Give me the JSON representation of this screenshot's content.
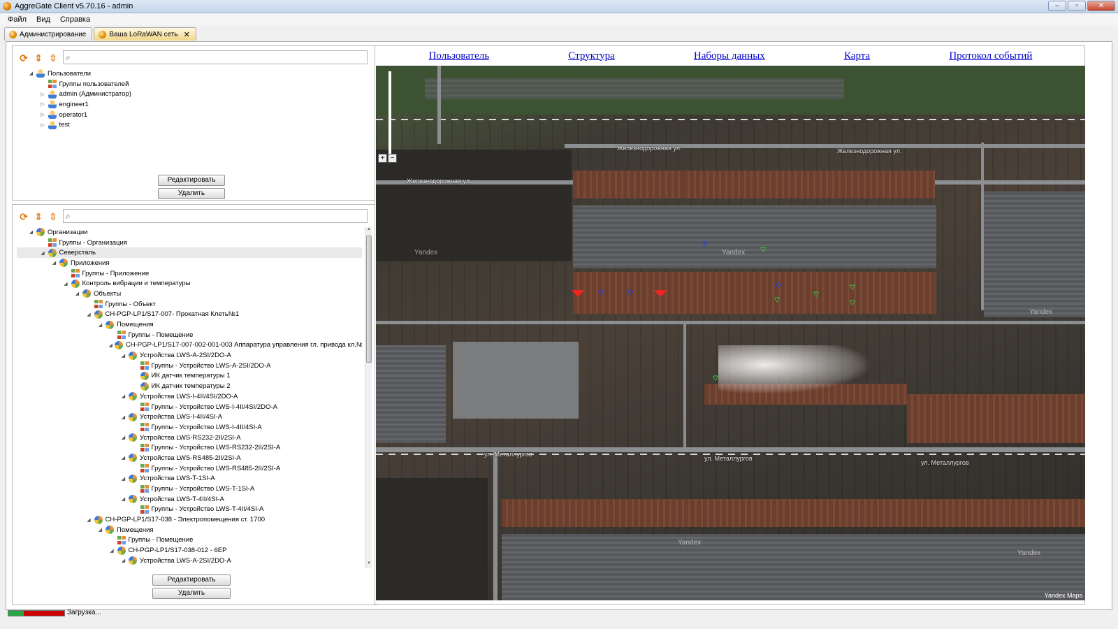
{
  "window": {
    "title": "AggreGate Client v5.70.16 - admin",
    "minimize": "–",
    "maximize": "▫",
    "close": "✕"
  },
  "menu": [
    "Файл",
    "Вид",
    "Справка"
  ],
  "tabs": [
    {
      "label": "Администрирование",
      "active": false
    },
    {
      "label": "Ваша LoRaWAN сеть",
      "active": true,
      "close": "✕"
    }
  ],
  "top_panel": {
    "search_placeholder": "",
    "tree": [
      {
        "label": "Пользователи",
        "level": 0,
        "twisty": "◢",
        "icon": "user"
      },
      {
        "label": "Группы пользователей",
        "level": 1,
        "twisty": "",
        "icon": "grid"
      },
      {
        "label": "admin (Администратор)",
        "level": 1,
        "twisty": "▷",
        "icon": "user"
      },
      {
        "label": "engineer1",
        "level": 1,
        "twisty": "▷",
        "icon": "user"
      },
      {
        "label": "operator1",
        "level": 1,
        "twisty": "▷",
        "icon": "user"
      },
      {
        "label": "test",
        "level": 1,
        "twisty": "▷",
        "icon": "user"
      }
    ],
    "edit_label": "Редактировать",
    "delete_label": "Удалить"
  },
  "bottom_panel": {
    "search_placeholder": "",
    "tree": [
      {
        "label": "Организации",
        "level": 0,
        "twisty": "◢",
        "icon": "globe"
      },
      {
        "label": "Группы - Организация",
        "level": 1,
        "twisty": "",
        "icon": "grid"
      },
      {
        "label": "Северсталь",
        "level": 1,
        "twisty": "◢",
        "icon": "globe",
        "selected": true
      },
      {
        "label": "Приложения",
        "level": 2,
        "twisty": "◢",
        "icon": "globe"
      },
      {
        "label": "Группы - Приложение",
        "level": 3,
        "twisty": "",
        "icon": "grid"
      },
      {
        "label": "Контроль вибрации и температуры",
        "level": 3,
        "twisty": "◢",
        "icon": "globe"
      },
      {
        "label": "Объекты",
        "level": 4,
        "twisty": "◢",
        "icon": "globe"
      },
      {
        "label": "Группы - Объект",
        "level": 5,
        "twisty": "",
        "icon": "grid"
      },
      {
        "label": "CH-PGP-LP1/S17-007- Прокатная Клеть№1",
        "level": 5,
        "twisty": "◢",
        "icon": "globe"
      },
      {
        "label": "Помещения",
        "level": 6,
        "twisty": "◢",
        "icon": "globe"
      },
      {
        "label": "Группы - Помещение",
        "level": 7,
        "twisty": "",
        "icon": "grid"
      },
      {
        "label": "CH-PGP-LP1/S17-007-002-001-003 Аппаратура управления гл. привода кл.№1",
        "level": 7,
        "twisty": "◢",
        "icon": "globe"
      },
      {
        "label": "Устройства LWS-A-2SI/2DO-A",
        "level": 8,
        "twisty": "◢",
        "icon": "globe"
      },
      {
        "label": "Группы - Устройство LWS-A-2SI/2DO-A",
        "level": 9,
        "twisty": "",
        "icon": "grid"
      },
      {
        "label": "ИК датчик температуры 1",
        "level": 9,
        "twisty": "",
        "icon": "globe"
      },
      {
        "label": "ИК датчик температуры 2",
        "level": 9,
        "twisty": "",
        "icon": "globe"
      },
      {
        "label": "Устройства LWS-I-4II/4SI/2DO-A",
        "level": 8,
        "twisty": "◢",
        "icon": "globe"
      },
      {
        "label": "Группы - Устройство LWS-I-4II/4SI/2DO-A",
        "level": 9,
        "twisty": "",
        "icon": "grid"
      },
      {
        "label": "Устройства LWS-I-4II/4SI-A",
        "level": 8,
        "twisty": "◢",
        "icon": "globe"
      },
      {
        "label": "Группы - Устройство LWS-I-4II/4SI-A",
        "level": 9,
        "twisty": "",
        "icon": "grid"
      },
      {
        "label": "Устройства LWS-RS232-2II/2SI-A",
        "level": 8,
        "twisty": "◢",
        "icon": "globe"
      },
      {
        "label": "Группы - Устройство LWS-RS232-2II/2SI-A",
        "level": 9,
        "twisty": "",
        "icon": "grid"
      },
      {
        "label": "Устройства LWS-RS485-2II/2SI-A",
        "level": 8,
        "twisty": "◢",
        "icon": "globe"
      },
      {
        "label": "Группы - Устройство LWS-RS485-2II/2SI-A",
        "level": 9,
        "twisty": "",
        "icon": "grid"
      },
      {
        "label": "Устройства LWS-T-1SI-A",
        "level": 8,
        "twisty": "◢",
        "icon": "globe"
      },
      {
        "label": "Группы - Устройство LWS-T-1SI-A",
        "level": 9,
        "twisty": "",
        "icon": "grid"
      },
      {
        "label": "Устройства LWS-T-4II/4SI-A",
        "level": 8,
        "twisty": "◢",
        "icon": "globe"
      },
      {
        "label": "Группы - Устройство LWS-T-4II/4SI-A",
        "level": 9,
        "twisty": "",
        "icon": "grid"
      },
      {
        "label": "CH-PGP-LP1/S17-038 - Электропомещения ст. 1700",
        "level": 5,
        "twisty": "◢",
        "icon": "globe"
      },
      {
        "label": "Помещения",
        "level": 6,
        "twisty": "◢",
        "icon": "globe"
      },
      {
        "label": "Группы - Помещение",
        "level": 7,
        "twisty": "",
        "icon": "grid"
      },
      {
        "label": "CH-PGP-LP1/S17-038-012 - 6ЕР",
        "level": 7,
        "twisty": "◢",
        "icon": "globe"
      },
      {
        "label": "Устройства LWS-A-2SI/2DO-A",
        "level": 8,
        "twisty": "◢",
        "icon": "globe"
      }
    ],
    "edit_label": "Редактировать",
    "delete_label": "Удалить"
  },
  "nav_links": [
    "Пользователь",
    "Структура",
    "Наборы данных",
    "Карта",
    "Протокол событий"
  ],
  "map": {
    "street_labels": [
      "Железнодорожная ул.",
      "Железнодорожная ул.",
      "Железнодорожная ул.",
      "ул. Металлургов",
      "ул. Металлургов",
      "ул. Металлургов"
    ],
    "watermark": "Yandex",
    "attribution": "Yandex Maps",
    "zoom_in": "+",
    "zoom_out": "−",
    "marker_colors": {
      "ok": "#2ecc40",
      "warning": "#1a3cff",
      "alarm": "#ff2020"
    }
  },
  "status": {
    "text": "Загрузка...",
    "progress": 0.28
  }
}
